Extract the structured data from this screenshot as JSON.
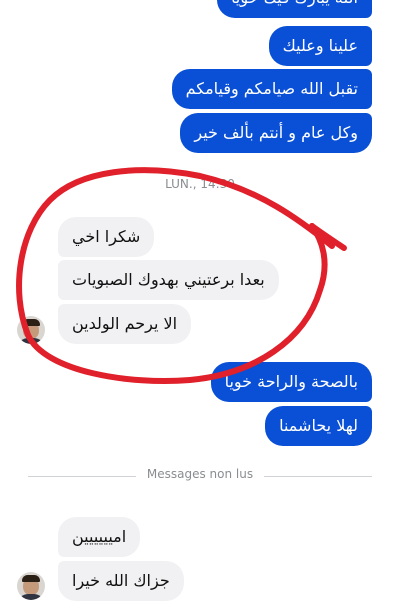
{
  "outgoing_top": [
    {
      "text": "الله يبارك فيك خويا"
    },
    {
      "text": "علينا وعليك"
    },
    {
      "text": "تقبل الله صيامكم وقيامكم"
    },
    {
      "text": "وكل عام و أنتم بألف خير"
    }
  ],
  "timestamp": "LUN., 14:30",
  "incoming_1": [
    {
      "text": "شكرا اخي"
    },
    {
      "text": "بعدا برعتيني بهدوك الصبويات"
    },
    {
      "text": "الا يرحم الولدين"
    }
  ],
  "outgoing_2": [
    {
      "text": "بالصحة والراحة خويا"
    },
    {
      "text": "لهلا يحاشمنا"
    }
  ],
  "divider": "Messages non lus",
  "incoming_2": [
    {
      "text": "اميييييين"
    },
    {
      "text": "جزاك الله خيرا"
    }
  ],
  "colors": {
    "outgoing_bubble": "#0a50d6",
    "incoming_bubble": "#f1f1f3",
    "annotation_circle": "#e0202a"
  }
}
